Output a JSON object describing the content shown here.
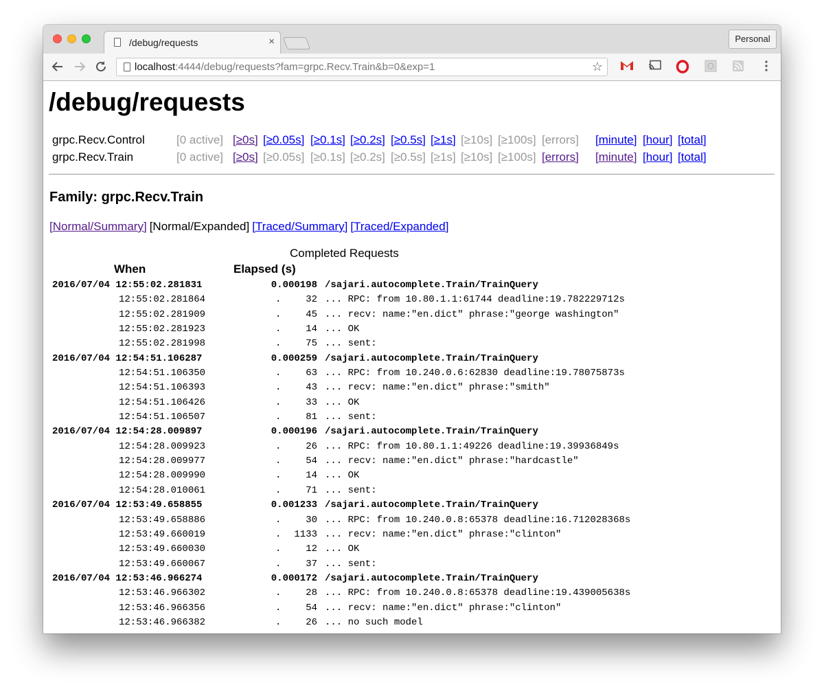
{
  "browser": {
    "tab_title": "/debug/requests",
    "tab_close": "×",
    "profile": "Personal",
    "url_host": "localhost",
    "url_rest": ":4444/debug/requests?fam=grpc.Recv.Train&b=0&exp=1",
    "icons": [
      "back-icon",
      "forward-icon",
      "reload-icon",
      "page-icon",
      "star-icon",
      "gmail-icon",
      "cast-icon",
      "opera-icon",
      "extension-icon",
      "rss-icon",
      "menu-icon"
    ]
  },
  "page": {
    "title": "/debug/requests",
    "families": [
      {
        "name": "grpc.Recv.Control",
        "active": "[0 active]",
        "buckets": [
          {
            "label": "[≥0s]",
            "state": "visited"
          },
          {
            "label": "[≥0.05s]",
            "state": "link"
          },
          {
            "label": "[≥0.1s]",
            "state": "link"
          },
          {
            "label": "[≥0.2s]",
            "state": "link"
          },
          {
            "label": "[≥0.5s]",
            "state": "link"
          },
          {
            "label": "[≥1s]",
            "state": "link"
          },
          {
            "label": "[≥10s]",
            "state": "disabled"
          },
          {
            "label": "[≥100s]",
            "state": "disabled"
          },
          {
            "label": "[errors]",
            "state": "disabled"
          }
        ],
        "rates": [
          {
            "label": "[minute]",
            "state": "link"
          },
          {
            "label": "[hour]",
            "state": "link"
          },
          {
            "label": "[total]",
            "state": "link"
          }
        ]
      },
      {
        "name": "grpc.Recv.Train",
        "active": "[0 active]",
        "buckets": [
          {
            "label": "[≥0s]",
            "state": "visited"
          },
          {
            "label": "[≥0.05s]",
            "state": "disabled"
          },
          {
            "label": "[≥0.1s]",
            "state": "disabled"
          },
          {
            "label": "[≥0.2s]",
            "state": "disabled"
          },
          {
            "label": "[≥0.5s]",
            "state": "disabled"
          },
          {
            "label": "[≥1s]",
            "state": "disabled"
          },
          {
            "label": "[≥10s]",
            "state": "disabled"
          },
          {
            "label": "[≥100s]",
            "state": "disabled"
          },
          {
            "label": "[errors]",
            "state": "visited"
          }
        ],
        "rates": [
          {
            "label": "[minute]",
            "state": "visited"
          },
          {
            "label": "[hour]",
            "state": "link"
          },
          {
            "label": "[total]",
            "state": "link"
          }
        ]
      }
    ],
    "family_heading": "Family: grpc.Recv.Train",
    "views": [
      {
        "label": "[Normal/Summary]",
        "state": "visited"
      },
      {
        "label": "[Normal/Expanded]",
        "state": "current"
      },
      {
        "label": "[Traced/Summary]",
        "state": "link"
      },
      {
        "label": "[Traced/Expanded]",
        "state": "link"
      }
    ],
    "table_caption": "Completed Requests",
    "col_when": "When",
    "col_elapsed": "Elapsed (s)",
    "requests": [
      {
        "when": "2016/07/04 12:55:02.281831",
        "elapsed": "0.000198",
        "name": "/sajari.autocomplete.Train/TrainQuery",
        "events": [
          {
            "when": "12:55:02.281864",
            "delta": "32",
            "msg": "... RPC: from 10.80.1.1:61744 deadline:19.782229712s"
          },
          {
            "when": "12:55:02.281909",
            "delta": "45",
            "msg": "... recv: name:\"en.dict\" phrase:\"george washington\""
          },
          {
            "when": "12:55:02.281923",
            "delta": "14",
            "msg": "... OK"
          },
          {
            "when": "12:55:02.281998",
            "delta": "75",
            "msg": "... sent:"
          }
        ]
      },
      {
        "when": "2016/07/04 12:54:51.106287",
        "elapsed": "0.000259",
        "name": "/sajari.autocomplete.Train/TrainQuery",
        "events": [
          {
            "when": "12:54:51.106350",
            "delta": "63",
            "msg": "... RPC: from 10.240.0.6:62830 deadline:19.78075873s"
          },
          {
            "when": "12:54:51.106393",
            "delta": "43",
            "msg": "... recv: name:\"en.dict\" phrase:\"smith\""
          },
          {
            "when": "12:54:51.106426",
            "delta": "33",
            "msg": "... OK"
          },
          {
            "when": "12:54:51.106507",
            "delta": "81",
            "msg": "... sent:"
          }
        ]
      },
      {
        "when": "2016/07/04 12:54:28.009897",
        "elapsed": "0.000196",
        "name": "/sajari.autocomplete.Train/TrainQuery",
        "events": [
          {
            "when": "12:54:28.009923",
            "delta": "26",
            "msg": "... RPC: from 10.80.1.1:49226 deadline:19.39936849s"
          },
          {
            "when": "12:54:28.009977",
            "delta": "54",
            "msg": "... recv: name:\"en.dict\" phrase:\"hardcastle\""
          },
          {
            "when": "12:54:28.009990",
            "delta": "14",
            "msg": "... OK"
          },
          {
            "when": "12:54:28.010061",
            "delta": "71",
            "msg": "... sent:"
          }
        ]
      },
      {
        "when": "2016/07/04 12:53:49.658855",
        "elapsed": "0.001233",
        "name": "/sajari.autocomplete.Train/TrainQuery",
        "events": [
          {
            "when": "12:53:49.658886",
            "delta": "30",
            "msg": "... RPC: from 10.240.0.8:65378 deadline:16.712028368s"
          },
          {
            "when": "12:53:49.660019",
            "delta": "1133",
            "msg": "... recv: name:\"en.dict\" phrase:\"clinton\""
          },
          {
            "when": "12:53:49.660030",
            "delta": "12",
            "msg": "... OK"
          },
          {
            "when": "12:53:49.660067",
            "delta": "37",
            "msg": "... sent:"
          }
        ]
      },
      {
        "when": "2016/07/04 12:53:46.966274",
        "elapsed": "0.000172",
        "name": "/sajari.autocomplete.Train/TrainQuery",
        "events": [
          {
            "when": "12:53:46.966302",
            "delta": "28",
            "msg": "... RPC: from 10.240.0.8:65378 deadline:19.439005638s"
          },
          {
            "when": "12:53:46.966356",
            "delta": "54",
            "msg": "... recv: name:\"en.dict\" phrase:\"clinton\""
          },
          {
            "when": "12:53:46.966382",
            "delta": "26",
            "msg": "... no such model"
          }
        ]
      }
    ]
  }
}
